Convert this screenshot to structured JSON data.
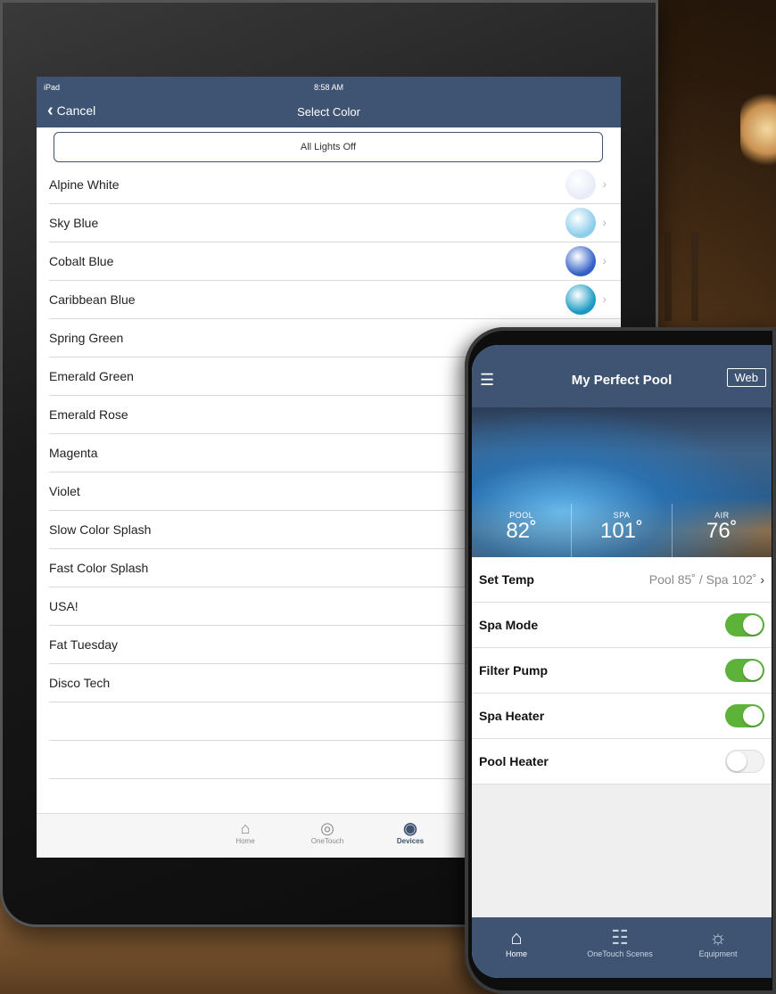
{
  "ipad": {
    "status_left": "iPad",
    "status_time": "8:58 AM",
    "cancel_label": "Cancel",
    "title": "Select Color",
    "all_off_label": "All Lights Off",
    "colors": [
      {
        "label": "Alpine White",
        "swatch": "#e8ecf8"
      },
      {
        "label": "Sky Blue",
        "swatch": "#8ccdeb"
      },
      {
        "label": "Cobalt Blue",
        "swatch": "#3360c8"
      },
      {
        "label": "Caribbean Blue",
        "swatch": "#1a9ac4"
      },
      {
        "label": "Spring Green",
        "swatch": ""
      },
      {
        "label": "Emerald Green",
        "swatch": ""
      },
      {
        "label": "Emerald Rose",
        "swatch": ""
      },
      {
        "label": "Magenta",
        "swatch": ""
      },
      {
        "label": "Violet",
        "swatch": ""
      },
      {
        "label": "Slow Color Splash",
        "swatch": ""
      },
      {
        "label": "Fast Color Splash",
        "swatch": ""
      },
      {
        "label": "USA!",
        "swatch": ""
      },
      {
        "label": "Fat Tuesday",
        "swatch": ""
      },
      {
        "label": "Disco Tech",
        "swatch": ""
      }
    ],
    "tabs": [
      {
        "label": "Home",
        "icon": "home-icon"
      },
      {
        "label": "OneTouch",
        "icon": "onetouch-icon"
      },
      {
        "label": "Devices",
        "icon": "devices-icon"
      }
    ]
  },
  "phone": {
    "title": "My Perfect Pool",
    "web_label": "Web",
    "temps": [
      {
        "label": "POOL",
        "value": "82˚"
      },
      {
        "label": "SPA",
        "value": "101˚"
      },
      {
        "label": "AIR",
        "value": "76˚"
      }
    ],
    "set_temp": {
      "label": "Set Temp",
      "value": "Pool 85˚ / Spa 102˚"
    },
    "switches": [
      {
        "label": "Spa Mode",
        "on": true
      },
      {
        "label": "Filter Pump",
        "on": true
      },
      {
        "label": "Spa Heater",
        "on": true
      },
      {
        "label": "Pool Heater",
        "on": false
      }
    ],
    "tabs": [
      {
        "label": "Home",
        "icon": "home-icon"
      },
      {
        "label": "OneTouch Scenes",
        "icon": "scenes-icon"
      },
      {
        "label": "Equipment",
        "icon": "lightbulb-icon"
      }
    ]
  },
  "colors": {
    "nav_bg": "#3f5472",
    "toggle_on": "#5db33a"
  }
}
